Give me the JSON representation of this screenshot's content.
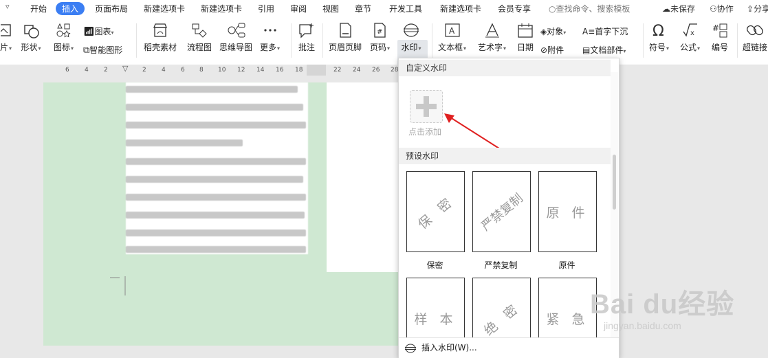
{
  "menubar": {
    "items": [
      "开始",
      "插入",
      "页面布局",
      "新建选项卡",
      "新建选项卡",
      "引用",
      "审阅",
      "视图",
      "章节",
      "开发工具",
      "新建选项卡",
      "会员专享"
    ],
    "search_placeholder": "查找命令、搜索模板",
    "unsaved": "未保存",
    "collab": "协作",
    "share": "分享"
  },
  "ribbon": {
    "picture": "片",
    "shape": "形状",
    "icon": "图标",
    "chart": "图表",
    "smart_shape": "智能图形",
    "material": "稻壳素材",
    "flowchart": "流程图",
    "mindmap": "思维导图",
    "more": "更多",
    "comment": "批注",
    "header_footer": "页眉页脚",
    "page_number": "页码",
    "watermark": "水印",
    "textbox": "文本框",
    "wordart": "艺术字",
    "date": "日期",
    "object": "对象",
    "attachment": "附件",
    "dropcap": "首字下沉",
    "doc_parts": "文档部件",
    "symbol": "符号",
    "formula": "公式",
    "numbering": "编号",
    "hyperlink": "超链接"
  },
  "ruler": [
    "6",
    "4",
    "2",
    "2",
    "4",
    "6",
    "8",
    "10",
    "12",
    "14",
    "16",
    "18",
    "22",
    "24",
    "26",
    "28"
  ],
  "dropdown": {
    "custom_title": "自定义水印",
    "add_label": "点击添加",
    "preset_title": "预设水印",
    "presets": [
      {
        "text": "保 密",
        "label": "保密"
      },
      {
        "text": "严禁复制",
        "label": "严禁复制"
      },
      {
        "text": "原 件",
        "label": "原件"
      },
      {
        "text": "样 本",
        "label": ""
      },
      {
        "text": "绝 密",
        "label": ""
      },
      {
        "text": "紧 急",
        "label": ""
      }
    ],
    "insert": "插入水印(W)..."
  },
  "watermark_site": {
    "logo": "Bai du经验",
    "url": "jingyan.baidu.com"
  },
  "colors": {
    "accent": "#3b7ef3",
    "page_green": "#cfe8d2",
    "arrow": "#e02020"
  }
}
